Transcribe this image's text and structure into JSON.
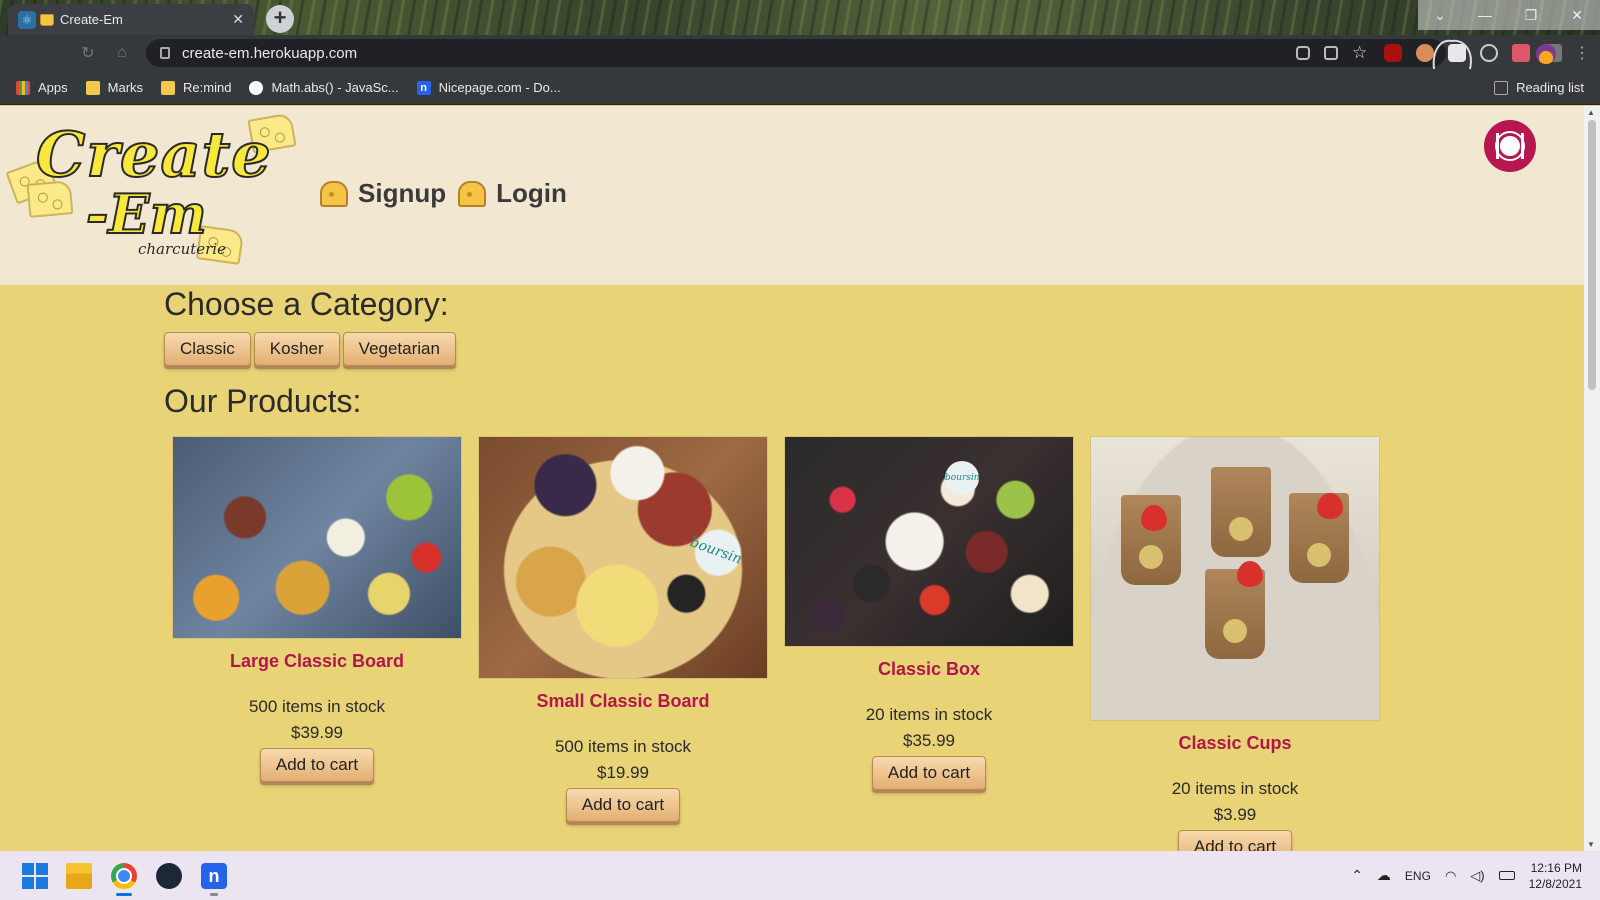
{
  "browser": {
    "tab_title": "Create-Em",
    "new_tab": "+",
    "tab_close": "✕",
    "url": "create-em.herokuapp.com",
    "window_controls": {
      "dropdown": "⌄",
      "minimize": "—",
      "restore": "❐",
      "close": "✕"
    },
    "bookmarks": [
      {
        "label": "Apps",
        "icon": "apps-grid-icon"
      },
      {
        "label": "Marks",
        "icon": "folder-icon"
      },
      {
        "label": "Re:mind",
        "icon": "folder-icon"
      },
      {
        "label": "Math.abs() - JavaSc...",
        "icon": "mdn-icon"
      },
      {
        "label": "Nicepage.com - Do...",
        "icon": "nicepage-icon"
      }
    ],
    "reading_list": "Reading list"
  },
  "site": {
    "logo": {
      "line1": "Create",
      "line2": "-Em",
      "sub": "charcuterie"
    },
    "nav": {
      "signup": "Signup",
      "login": "Login"
    },
    "category_heading": "Choose a Category:",
    "categories": [
      "Classic",
      "Kosher",
      "Vegetarian"
    ],
    "products_heading": "Our Products:",
    "products": [
      {
        "name": "Large Classic Board",
        "stock": "500 items in stock",
        "price": "$39.99",
        "button": "Add to cart"
      },
      {
        "name": "Small Classic Board",
        "stock": "500 items in stock",
        "price": "$19.99",
        "button": "Add to cart"
      },
      {
        "name": "Classic Box",
        "stock": "20 items in stock",
        "price": "$35.99",
        "button": "Add to cart"
      },
      {
        "name": "Classic Cups",
        "stock": "20 items in stock",
        "price": "$3.99",
        "button": "Add to cart"
      }
    ],
    "image_labels": {
      "boursin": "boursin"
    }
  },
  "taskbar": {
    "language": "ENG",
    "time": "12:16 PM",
    "date": "12/8/2021"
  },
  "colors": {
    "page_bg": "#e8d376",
    "header_bg": "#f2e8d2",
    "product_name": "#b0174a",
    "accent_plate": "#b5174e"
  }
}
